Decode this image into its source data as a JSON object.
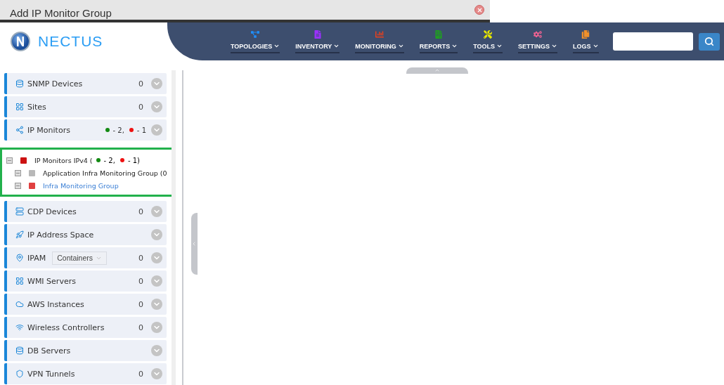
{
  "window": {
    "title": "Add IP Monitor Group"
  },
  "logo": {
    "text": "NECTUS"
  },
  "nav": [
    {
      "label": "TOPOLOGIES",
      "color": "#1e90ff"
    },
    {
      "label": "INVENTORY",
      "color": "#9b30ff"
    },
    {
      "label": "MONITORING",
      "color": "#e8401c"
    },
    {
      "label": "REPORTS",
      "color": "#1ea11e"
    },
    {
      "label": "TOOLS",
      "color": "#e6e600"
    },
    {
      "label": "SETTINGS",
      "color": "#f06292"
    },
    {
      "label": "LOGS",
      "color": "#f0902a"
    }
  ],
  "sidebar_top": [
    {
      "label": "SNMP Devices",
      "count": "0"
    },
    {
      "label": "Sites",
      "count": "0"
    },
    {
      "label": "IP Monitors",
      "statuses": [
        {
          "color": "#138a13",
          "text": "- 2,"
        },
        {
          "color": "#ee1111",
          "text": "- 1"
        }
      ]
    }
  ],
  "tree": [
    {
      "label": "IP Monitors IPv4 (",
      "color": "#cc1111",
      "selected": false,
      "statuses": [
        {
          "color": "#138a13",
          "text": "- 2,"
        },
        {
          "color": "#ee1111",
          "text": "- 1)"
        }
      ],
      "children": [
        {
          "label": "Application Infra Monitoring Group (0",
          "color": "#b8b8b8",
          "selected": false
        },
        {
          "label": "Infra Monitoring Group",
          "color": "#e04040",
          "selected": true
        }
      ]
    }
  ],
  "sidebar_bottom": [
    {
      "label": "CDP Devices",
      "count": "0"
    },
    {
      "label": "IP Address Space"
    },
    {
      "label": "IPAM",
      "dropdown": "Containers",
      "count": "0"
    },
    {
      "label": "WMI Servers",
      "count": "0"
    },
    {
      "label": "AWS Instances",
      "count": "0"
    },
    {
      "label": "Wireless Controllers",
      "count": "0"
    },
    {
      "label": "DB Servers"
    },
    {
      "label": "VPN Tunnels",
      "count": "0"
    }
  ]
}
